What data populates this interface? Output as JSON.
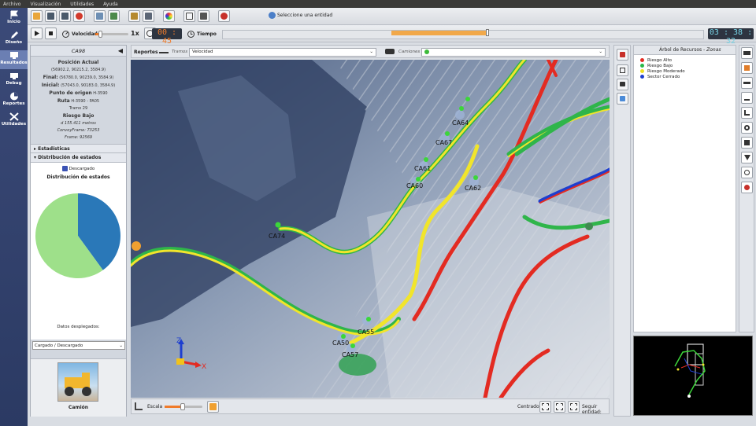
{
  "menu": [
    "Archivo",
    "Visualización",
    "Utilidades",
    "Ayuda"
  ],
  "nav": [
    {
      "label": "Inicio",
      "icon": "flag-icon"
    },
    {
      "label": "Diseño",
      "icon": "pencil-icon"
    },
    {
      "label": "Resultados",
      "icon": "monitor-icon"
    },
    {
      "label": "Debug",
      "icon": "bug-icon"
    },
    {
      "label": "Reportes",
      "icon": "pie-icon"
    },
    {
      "label": "Utilidades",
      "icon": "tools-icon"
    }
  ],
  "toolbar": {
    "entity_label": "Seleccione una entidad",
    "velocity_label": "Velocidad",
    "speed_multiplier": "1x",
    "elapsed_clock": "00 : 45",
    "time_label": "Tiempo",
    "total_clock": "03 : 38 : 32",
    "timeline_progress": 0.55
  },
  "left_panel": {
    "title": "CA98",
    "current_position_label": "Posición Actual",
    "current_position": "(56902.2, 90215.2, 3584.9)",
    "final_label": "Final:",
    "final_value": "(56780.0, 90239.0, 3584.9)",
    "initial_label": "Inicial:",
    "initial_value": "(57043.0, 90183.0, 3584.9)",
    "origin_label": "Punto de origen",
    "origin_value": "H-3590",
    "route_label": "Ruta",
    "route_value": "H-3590 - PA05",
    "segment": "Tramo 29",
    "risk": "Riesgo Bajo",
    "distance": "d 155.411 metros",
    "convoy_frame": "ConvoyFrame: 73253",
    "frame": "Frame: 92569",
    "stats_label": "Estadísticas",
    "dist_states_label": "Distribución de estados",
    "status_badge": "Descargado",
    "chart_title": "Distribución de estados",
    "data_display_label": "Datos desplegados:",
    "data_display_value": "Cargado / Descargado",
    "vehicle_label": "Camión"
  },
  "map_header": {
    "reports_label": "Reportes",
    "segments_label": "Tramos",
    "metric": "Velocidad",
    "trucks_label": "Camiones"
  },
  "map_footer": {
    "scale_label": "Escala",
    "center_label": "Centrado",
    "follow_label": "Seguir entidad:"
  },
  "map_trucks": [
    "CA74",
    "CA55",
    "CA50",
    "CA57",
    "CA60",
    "CA61",
    "CA67",
    "CA64",
    "CA62"
  ],
  "axis_labels": {
    "z": "Z",
    "x": "X"
  },
  "resource_tree": {
    "title": "Árbol de Recursos",
    "subtitle": "Zonas",
    "items": [
      {
        "label": "Riesgo Alto",
        "color": "#e32b22"
      },
      {
        "label": "Riesgo Bajo",
        "color": "#29b84a"
      },
      {
        "label": "Riesgo Moderado",
        "color": "#f0e020"
      },
      {
        "label": "Sector Cerrado",
        "color": "#1e3fcf"
      }
    ]
  },
  "chart_data": {
    "type": "pie",
    "title": "Distribución de estados",
    "values": [
      {
        "label": "Cargado",
        "value": 0.4,
        "color": "#2a78b8"
      },
      {
        "label": "Descargado",
        "value": 0.6,
        "color": "#9ee08a"
      }
    ]
  }
}
